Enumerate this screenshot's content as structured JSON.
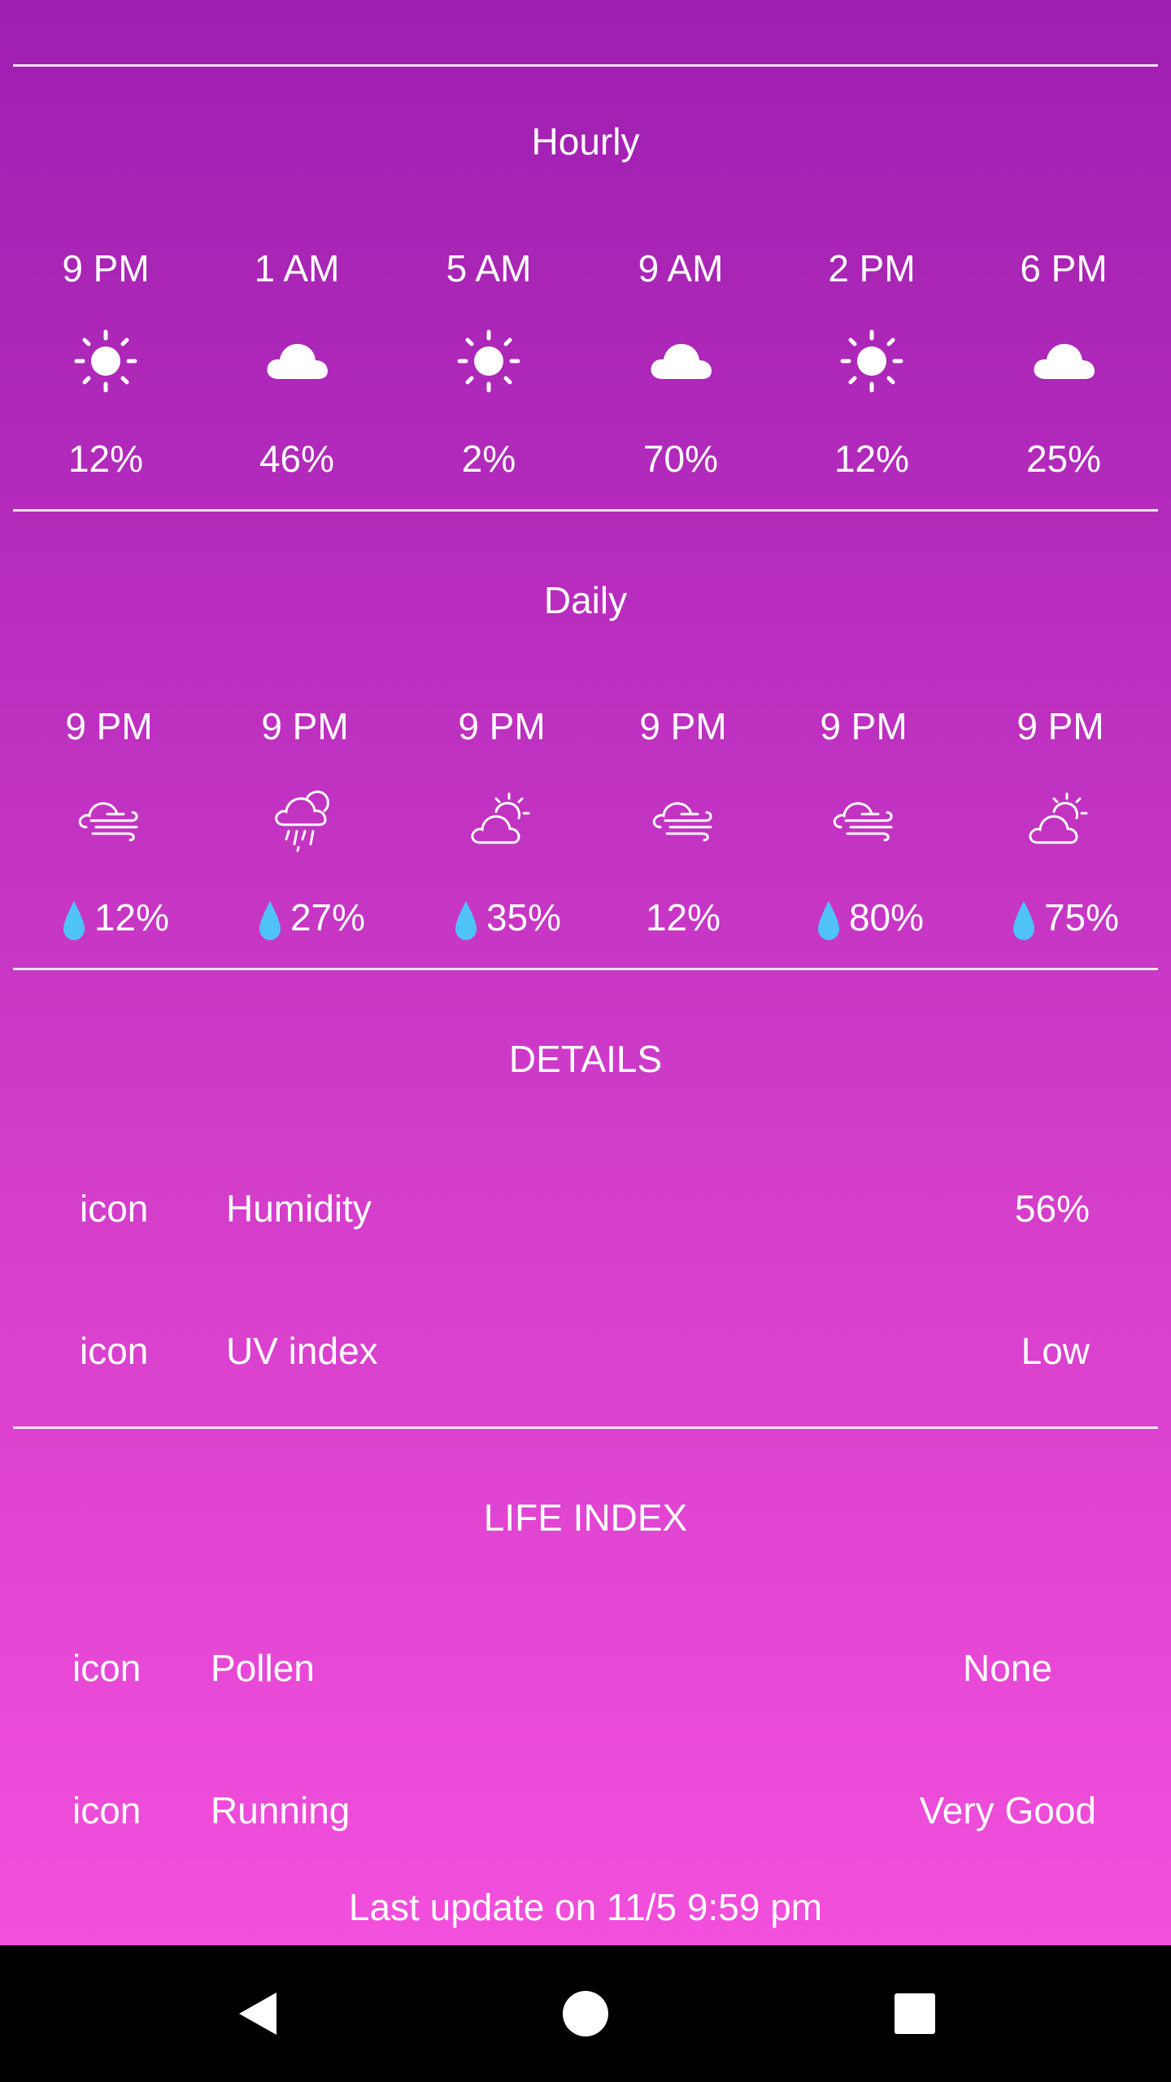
{
  "hourly": {
    "title": "Hourly",
    "items": [
      {
        "time": "9 PM",
        "icon": "sun-icon",
        "precip": "12%"
      },
      {
        "time": "1 AM",
        "icon": "cloud-icon",
        "precip": "46%"
      },
      {
        "time": "5 AM",
        "icon": "sun-icon",
        "precip": "2%"
      },
      {
        "time": "9 AM",
        "icon": "cloud-icon",
        "precip": "70%"
      },
      {
        "time": "2 PM",
        "icon": "sun-icon",
        "precip": "12%"
      },
      {
        "time": "6 PM",
        "icon": "cloud-icon",
        "precip": "25%"
      }
    ]
  },
  "daily": {
    "title": "Daily",
    "items": [
      {
        "time": "9 PM",
        "icon": "windy-cloud-icon",
        "precip": "12%",
        "drop": true
      },
      {
        "time": "9 PM",
        "icon": "rain-cloud-icon",
        "precip": "27%",
        "drop": true
      },
      {
        "time": "9 PM",
        "icon": "partly-cloudy-icon",
        "precip": "35%",
        "drop": true
      },
      {
        "time": "9 PM",
        "icon": "windy-cloud-icon",
        "precip": "12%",
        "drop": false
      },
      {
        "time": "9 PM",
        "icon": "windy-cloud-icon",
        "precip": "80%",
        "drop": true
      },
      {
        "time": "9 PM",
        "icon": "partly-cloudy-icon",
        "precip": "75%",
        "drop": true
      }
    ]
  },
  "details": {
    "title": "DETAILS",
    "rows": [
      {
        "icon": "icon",
        "label": "Humidity",
        "value": "56%"
      },
      {
        "icon": "icon",
        "label": "UV index",
        "value": "Low"
      }
    ]
  },
  "life_index": {
    "title": "LIFE INDEX",
    "rows": [
      {
        "icon": "icon",
        "label": "Pollen",
        "value": "None"
      },
      {
        "icon": "icon",
        "label": "Running",
        "value": "Very Good"
      }
    ]
  },
  "footer": {
    "last_update": "Last update on 11/5 9:59 pm"
  },
  "colors": {
    "drop": "#4fc3f7",
    "gradient_top": "#9e1fb0",
    "gradient_bottom": "#f24fdc"
  }
}
